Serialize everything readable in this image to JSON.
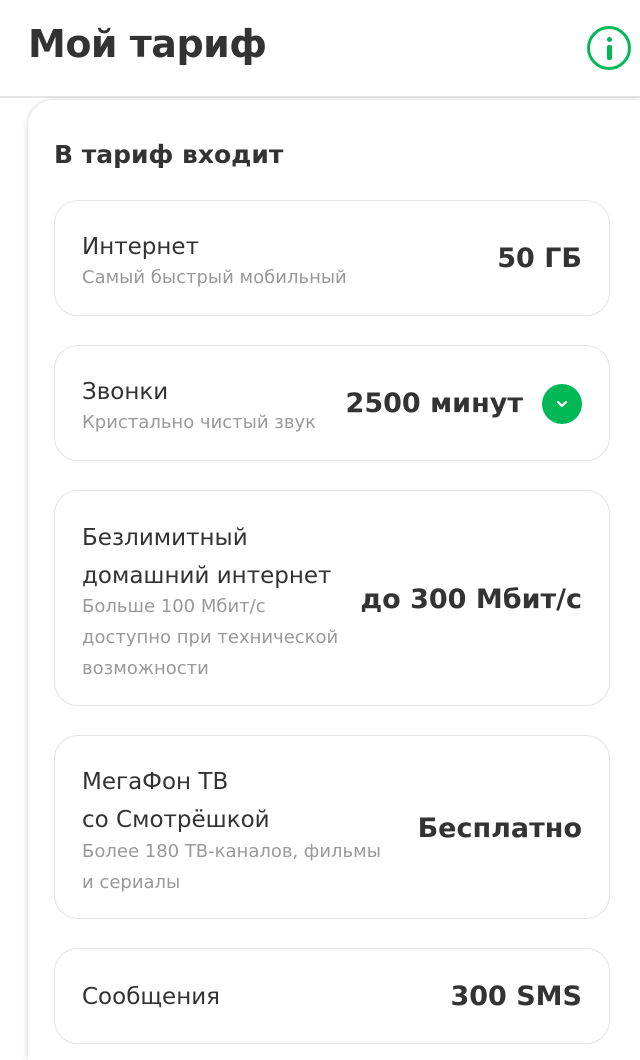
{
  "header": {
    "title": "Мой тариф",
    "info_icon": "info-circle-icon",
    "accent_color": "#00b956"
  },
  "panel": {
    "title": "В тариф входит"
  },
  "items": [
    {
      "name_lines": [
        "Интернет"
      ],
      "desc_lines": [
        "Самый быстрый мобильный"
      ],
      "value": "50 ГБ"
    },
    {
      "name_lines": [
        "Звонки"
      ],
      "desc_lines": [
        "Кристально чистый звук"
      ],
      "value": "2500 минут",
      "expand_icon": "chevron-down-icon"
    },
    {
      "name_lines": [
        "Безлимитный",
        "домашний интернет"
      ],
      "desc_lines": [
        "Больше 100 Мбит/с",
        "доступно при технической",
        "возможности"
      ],
      "value": "до 300 Мбит/с"
    },
    {
      "name_lines": [
        "МегаФон ТВ",
        "со Смотрёшкой"
      ],
      "desc_lines": [
        "Более 180 ТВ-каналов, фильмы",
        "и сериалы"
      ],
      "value": "Бесплатно"
    },
    {
      "name_lines": [
        "Сообщения"
      ],
      "desc_lines": [],
      "value": "300 SMS"
    }
  ]
}
